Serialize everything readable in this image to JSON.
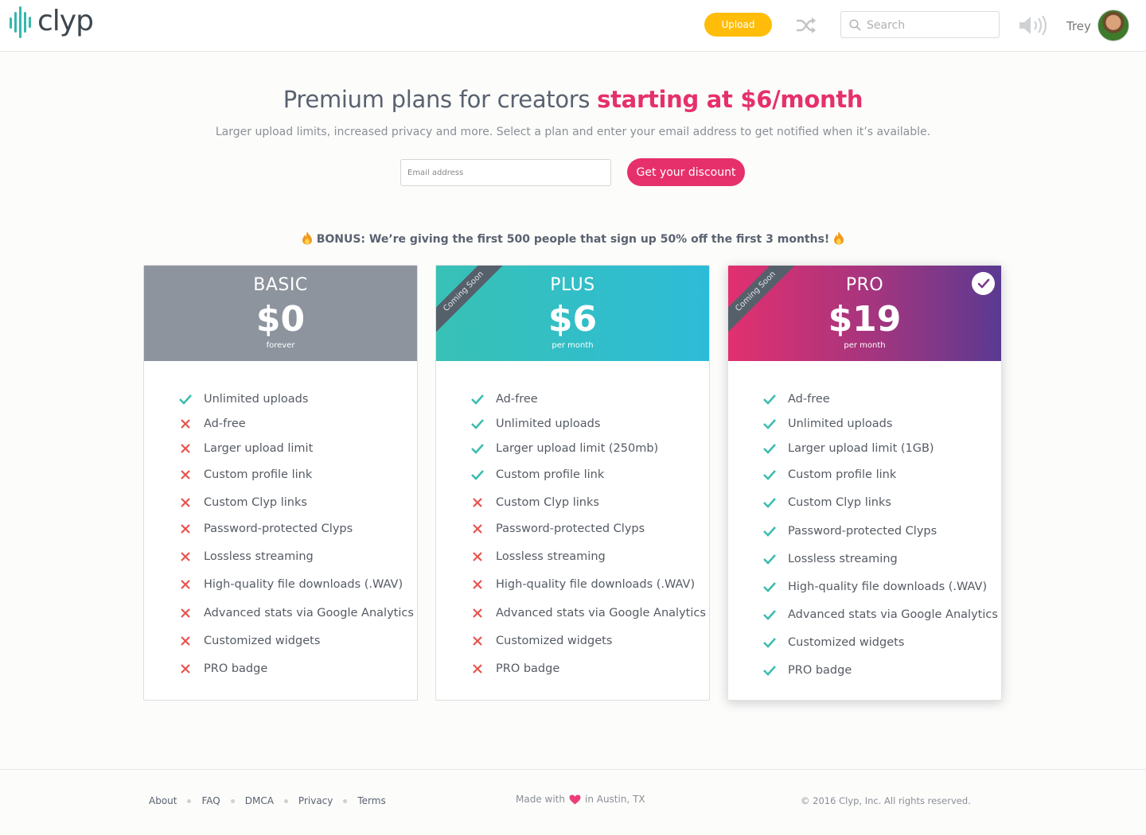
{
  "header": {
    "logo_text": "clyp",
    "upload_label": "Upload",
    "search_placeholder": "Search",
    "username": "Trey",
    "icons": [
      "logo-waveform-icon",
      "shuffle-icon",
      "search-icon",
      "volume-icon",
      "avatar"
    ]
  },
  "hero": {
    "title_plain": "Premium plans for creators ",
    "title_accent": "starting at $6/month",
    "subtitle": "Larger upload limits, increased privacy and more. Select a plan and enter your email address to get notified when it’s available.",
    "email_placeholder": "Email address",
    "discount_button": "Get your discount",
    "bonus": "BONUS: We’re giving the first 500 people that sign up 50% off the first 3 months!"
  },
  "plans": [
    {
      "name": "BASIC",
      "price": "$0",
      "period": "forever",
      "ribbon": "",
      "selected": false,
      "features": [
        {
          "label": "Unlimited uploads",
          "included": true
        },
        {
          "label": "Ad-free",
          "included": false
        },
        {
          "label": "Larger upload limit",
          "included": false
        },
        {
          "label": "Custom profile link",
          "included": false
        },
        {
          "label": "Custom Clyp links",
          "included": false
        },
        {
          "label": "Password-protected Clyps",
          "included": false
        },
        {
          "label": "Lossless streaming",
          "included": false
        },
        {
          "label": "High-quality file downloads (.WAV)",
          "included": false
        },
        {
          "label": "Advanced stats via Google Analytics",
          "included": false
        },
        {
          "label": "Customized widgets",
          "included": false
        },
        {
          "label": "PRO badge",
          "included": false
        }
      ]
    },
    {
      "name": "PLUS",
      "price": "$6",
      "period": "per month",
      "ribbon": "Coming Soon",
      "selected": false,
      "features": [
        {
          "label": "Ad-free",
          "included": true
        },
        {
          "label": "Unlimited uploads",
          "included": true
        },
        {
          "label": "Larger upload limit (250mb)",
          "included": true
        },
        {
          "label": "Custom profile link",
          "included": true
        },
        {
          "label": "Custom Clyp links",
          "included": false
        },
        {
          "label": "Password-protected Clyps",
          "included": false
        },
        {
          "label": "Lossless streaming",
          "included": false
        },
        {
          "label": "High-quality file downloads (.WAV)",
          "included": false
        },
        {
          "label": "Advanced stats via Google Analytics",
          "included": false
        },
        {
          "label": "Customized widgets",
          "included": false
        },
        {
          "label": "PRO badge",
          "included": false
        }
      ]
    },
    {
      "name": "PRO",
      "price": "$19",
      "period": "per month",
      "ribbon": "Coming Soon",
      "selected": true,
      "features": [
        {
          "label": "Ad-free",
          "included": true
        },
        {
          "label": "Unlimited uploads",
          "included": true
        },
        {
          "label": "Larger upload limit (1GB)",
          "included": true
        },
        {
          "label": "Custom profile link",
          "included": true
        },
        {
          "label": "Custom Clyp links",
          "included": true
        },
        {
          "label": "Password-protected Clyps",
          "included": true
        },
        {
          "label": "Lossless streaming",
          "included": true
        },
        {
          "label": "High-quality file downloads (.WAV)",
          "included": true
        },
        {
          "label": "Advanced stats via Google Analytics",
          "included": true
        },
        {
          "label": "Customized widgets",
          "included": true
        },
        {
          "label": "PRO badge",
          "included": true
        }
      ]
    }
  ],
  "footer": {
    "links": [
      "About",
      "FAQ",
      "DMCA",
      "Privacy",
      "Terms"
    ],
    "made_prefix": "Made with",
    "made_suffix": "in Austin, TX",
    "copyright": "© 2016 Clyp, Inc. All rights reserved."
  },
  "colors": {
    "accent": "#e6306b",
    "upload": "#ffbd0a",
    "check": "#3dbdb0",
    "cross": "#e8544e",
    "basic_header": "#8d949e",
    "plus_header": "#2dbcd8",
    "pro_header": "#5a3a92"
  }
}
